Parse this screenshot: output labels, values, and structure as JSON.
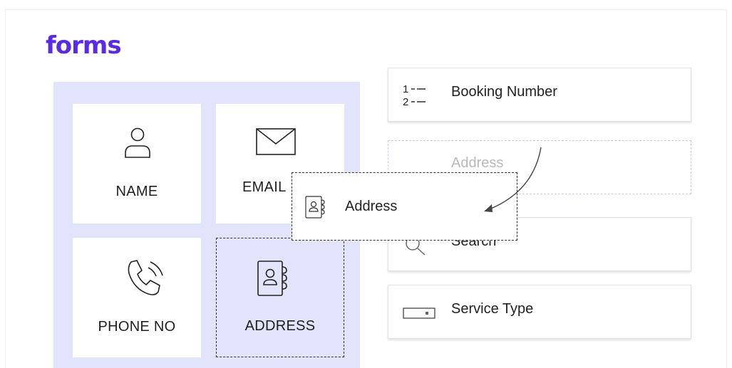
{
  "brand": {
    "logo_text": "forms",
    "color": "#5b2be0"
  },
  "palette": {
    "background": "#e1e4fb",
    "tiles": [
      {
        "label": "NAME",
        "icon": "user-icon"
      },
      {
        "label": "EMAIL",
        "icon": "envelope-icon"
      },
      {
        "label": "PHONE NO",
        "icon": "phone-icon"
      },
      {
        "label": "ADDRESS",
        "icon": "address-book-icon"
      }
    ]
  },
  "fields": [
    {
      "label": "Booking Number",
      "icon": "numbered-list-icon",
      "icon_text": [
        "1",
        "2"
      ]
    },
    {
      "label": "Address",
      "icon": "address-book-icon",
      "state": "drop-placeholder"
    },
    {
      "label": "Search",
      "icon": "search-icon"
    },
    {
      "label": "Service Type",
      "icon": "dropdown-icon"
    }
  ],
  "drag_card": {
    "label": "Address",
    "icon": "address-book-icon"
  }
}
